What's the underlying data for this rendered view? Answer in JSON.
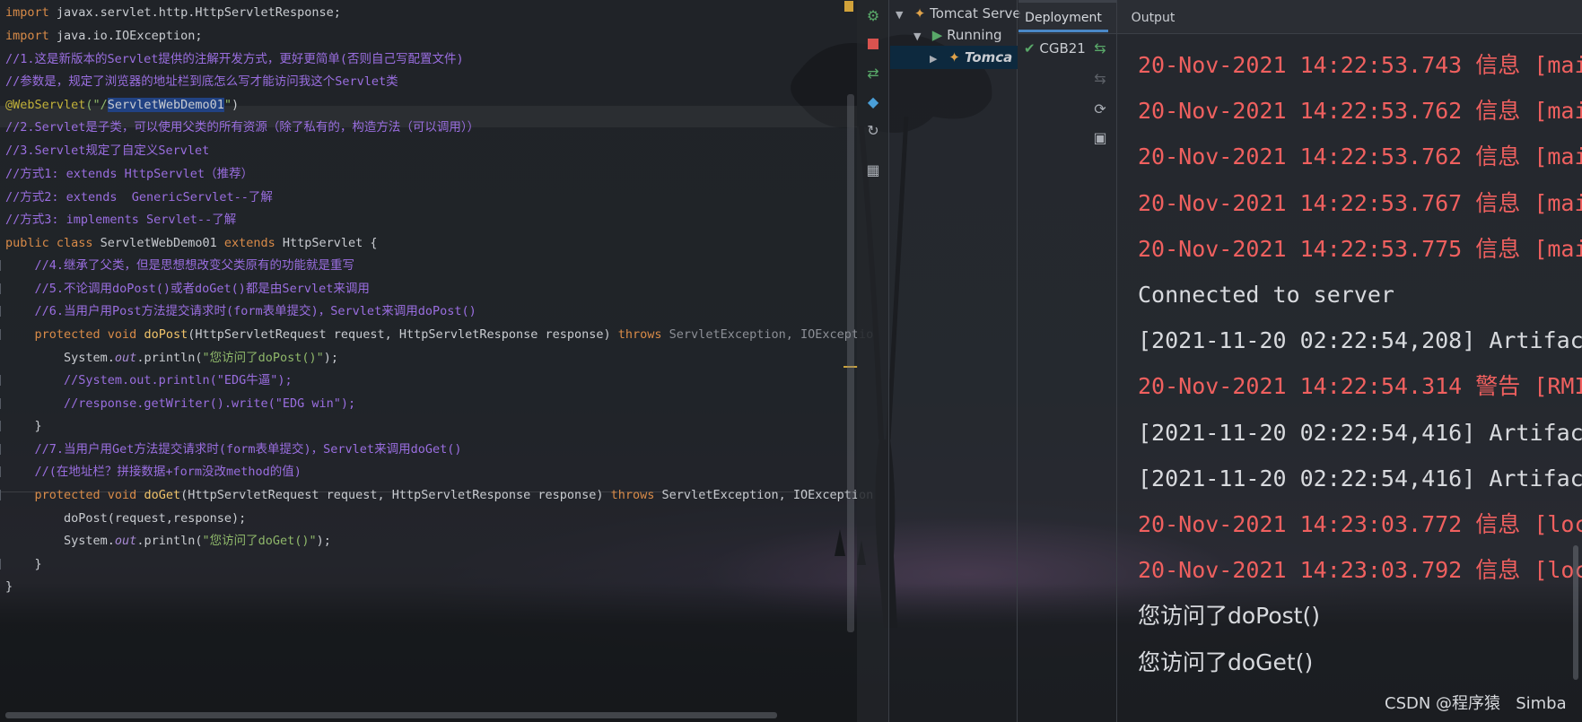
{
  "editor": {
    "lines": [
      {
        "parts": [
          {
            "t": "import",
            "c": "kw"
          },
          {
            "t": " javax.servlet.http.HttpServletResponse;",
            "c": ""
          }
        ]
      },
      {
        "parts": [
          {
            "t": "import",
            "c": "kw"
          },
          {
            "t": " java.io.IOException;",
            "c": ""
          }
        ]
      },
      {
        "parts": [
          {
            "t": "//1.这是新版本的Servlet提供的注解开发方式，更好更简单(否则自己写配置文件)",
            "c": "cmt"
          }
        ]
      },
      {
        "parts": [
          {
            "t": "//参数是，规定了浏览器的地址栏到底怎么写才能访问我这个Servlet类",
            "c": "cmt"
          }
        ]
      },
      {
        "parts": [
          {
            "t": "@WebServlet",
            "c": "ann"
          },
          {
            "t": "(\"/",
            "c": "str"
          },
          {
            "t": "ServletWebDemo01",
            "c": "sel"
          },
          {
            "t": "\"",
            "c": "str"
          },
          {
            "t": ")",
            "c": ""
          }
        ]
      },
      {
        "parts": [
          {
            "t": "//2.Servlet是子类，可以使用父类的所有资源（除了私有的，构造方法（可以调用））",
            "c": "cmt"
          }
        ]
      },
      {
        "parts": [
          {
            "t": "//3.Servlet规定了自定义Servlet",
            "c": "cmt"
          }
        ]
      },
      {
        "parts": [
          {
            "t": "//方式1: extends HttpServlet（推荐）",
            "c": "cmt"
          }
        ]
      },
      {
        "parts": [
          {
            "t": "//方式2: extends  GenericServlet--了解",
            "c": "cmt"
          }
        ]
      },
      {
        "parts": [
          {
            "t": "//方式3: implements Servlet--了解",
            "c": "cmt"
          }
        ]
      },
      {
        "parts": [
          {
            "t": "public class",
            "c": "kw"
          },
          {
            "t": " ServletWebDemo01 ",
            "c": ""
          },
          {
            "t": "extends",
            "c": "kw"
          },
          {
            "t": " HttpServlet {",
            "c": ""
          }
        ]
      },
      {
        "parts": [
          {
            "t": "    //4.继承了父类，但是思想想改变父类原有的功能就是重写",
            "c": "cmt"
          }
        ]
      },
      {
        "parts": [
          {
            "t": "    //5.不论调用doPost()或者doGet()都是由Servlet来调用",
            "c": "cmt"
          }
        ]
      },
      {
        "parts": [
          {
            "t": "    //6.当用户用Post方法提交请求时(form表单提交)，Servlet来调用doPost()",
            "c": "cmt"
          }
        ]
      },
      {
        "parts": [
          {
            "t": "    protected void",
            "c": "kw"
          },
          {
            "t": " doPost",
            "c": "fn"
          },
          {
            "t": "(HttpServletRequest request, HttpServletResponse response) ",
            "c": ""
          },
          {
            "t": "throws",
            "c": "kw"
          },
          {
            "t": " ServletException, IOExceptio",
            "c": "gray"
          }
        ]
      },
      {
        "parts": [
          {
            "t": "        System.",
            "c": ""
          },
          {
            "t": "out",
            "c": "ital"
          },
          {
            "t": ".println(",
            "c": ""
          },
          {
            "t": "\"您访问了doPost()\"",
            "c": "str"
          },
          {
            "t": ");",
            "c": ""
          }
        ]
      },
      {
        "parts": [
          {
            "t": "        //System.out.println(\"EDG牛逼\");",
            "c": "cmt"
          }
        ]
      },
      {
        "parts": [
          {
            "t": "        //response.getWriter().write(\"EDG win\");",
            "c": "cmt"
          }
        ]
      },
      {
        "parts": [
          {
            "t": "    }",
            "c": ""
          }
        ]
      },
      {
        "parts": [
          {
            "t": "    //7.当用户用Get方法提交请求时(form表单提交)，Servlet来调用doGet()",
            "c": "cmt"
          }
        ]
      },
      {
        "parts": [
          {
            "t": "    //(在地址栏？拼接数据+form没改method的值)",
            "c": "cmt"
          }
        ]
      },
      {
        "parts": [
          {
            "t": "    protected void",
            "c": "kw"
          },
          {
            "t": " doGet",
            "c": "fn"
          },
          {
            "t": "(HttpServletRequest request, HttpServletResponse response) ",
            "c": ""
          },
          {
            "t": "throws",
            "c": "kw"
          },
          {
            "t": " ServletException, IOException",
            "c": ""
          }
        ]
      },
      {
        "parts": [
          {
            "t": "        doPost(request,response);",
            "c": ""
          }
        ]
      },
      {
        "parts": [
          {
            "t": "        System.",
            "c": ""
          },
          {
            "t": "out",
            "c": "ital"
          },
          {
            "t": ".println(",
            "c": ""
          },
          {
            "t": "\"您访问了doGet()\"",
            "c": "str"
          },
          {
            "t": ");",
            "c": ""
          }
        ]
      },
      {
        "parts": [
          {
            "t": "    }",
            "c": ""
          }
        ]
      },
      {
        "parts": [
          {
            "t": "}",
            "c": ""
          }
        ]
      }
    ]
  },
  "services": {
    "tree": {
      "root_label": "Tomcat Serve",
      "running_label": "Running",
      "instance_label": "Tomca"
    },
    "tabs": {
      "deployment": "Deployment",
      "output": "Output"
    },
    "deployment_item": "CGB21",
    "console": [
      {
        "text": "20-Nov-2021 14:22:53.743 信息 [mai",
        "color": "red"
      },
      {
        "text": "20-Nov-2021 14:22:53.762 信息 [mai",
        "color": "red"
      },
      {
        "text": "20-Nov-2021 14:22:53.762 信息 [mai",
        "color": "red"
      },
      {
        "text": "20-Nov-2021 14:22:53.767 信息 [mai",
        "color": "red"
      },
      {
        "text": "20-Nov-2021 14:22:53.775 信息 [mai",
        "color": "red"
      },
      {
        "text": "Connected to server",
        "color": "white"
      },
      {
        "text": "[2021-11-20 02:22:54,208] Artifac",
        "color": "white"
      },
      {
        "text": "20-Nov-2021 14:22:54.314 警告 [RMI",
        "color": "red"
      },
      {
        "text": "[2021-11-20 02:22:54,416] Artifac",
        "color": "white"
      },
      {
        "text": "[2021-11-20 02:22:54,416] Artifac",
        "color": "white"
      },
      {
        "text": "20-Nov-2021 14:23:03.772 信息 [loc",
        "color": "red"
      },
      {
        "text": "20-Nov-2021 14:23:03.792 信息 [loc",
        "color": "red"
      },
      {
        "text": "您访问了doPost()",
        "color": "white"
      },
      {
        "text": "您访问了doGet()",
        "color": "white"
      }
    ]
  },
  "watermark": "CSDN @程序猿   Simba",
  "colors": {
    "keyword": "#d98b48",
    "comment": "#9a6ee0",
    "annotation": "#c3b23a",
    "string": "#8fb86a",
    "log_red": "#f0605f",
    "log_white": "#d8dade",
    "selection": "#214283"
  }
}
